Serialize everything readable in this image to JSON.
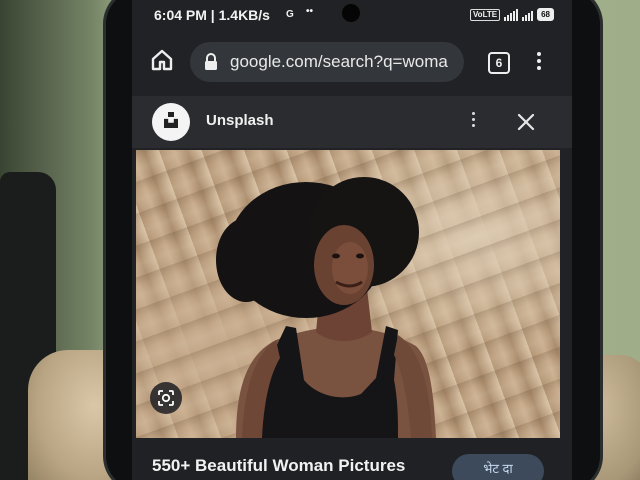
{
  "status_bar": {
    "time_speed": "6:04 PM | 1.4KB/s",
    "g_indicator": "G",
    "more_indicator": "••",
    "volte_label": "VoLTE",
    "battery": "68"
  },
  "browser": {
    "url": "google.com/search?q=woma",
    "tab_count": "6"
  },
  "custom_tab": {
    "site_name": "Unsplash"
  },
  "result": {
    "title": "550+ Beautiful Woman Pictures",
    "visit_label": "भेट दा"
  },
  "colors": {
    "browser_bg": "#202225",
    "urlbar_bg": "#33363a",
    "visit_button_bg": "#3c4a5c",
    "visit_button_text": "#c8d8ee"
  },
  "icons": {
    "home": "home-icon",
    "lock": "lock-icon",
    "menu": "more-vert-icon",
    "close": "close-icon",
    "lens": "lens-icon",
    "site_logo": "unsplash-logo-icon"
  }
}
